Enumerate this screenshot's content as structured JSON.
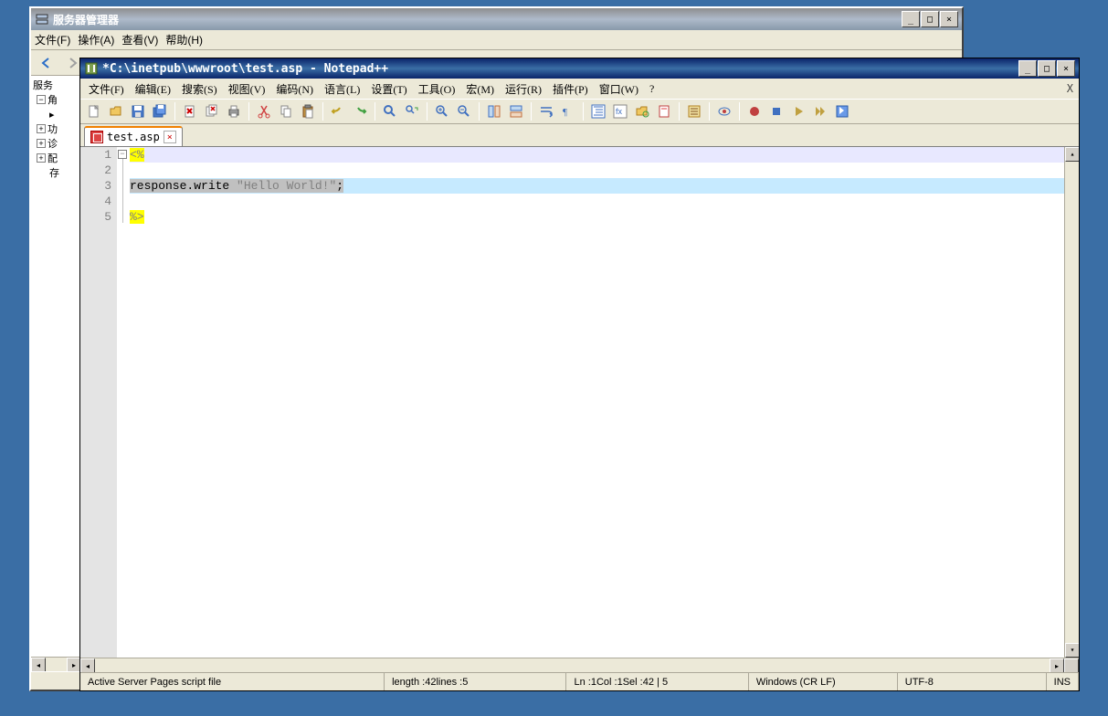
{
  "bg_window": {
    "title": "服务器管理器",
    "menu": [
      "文件(F)",
      "操作(A)",
      "查看(V)",
      "帮助(H)"
    ],
    "tree": {
      "root": "服务",
      "items": [
        "角",
        "功",
        "诊",
        "配",
        "存"
      ]
    }
  },
  "npp": {
    "title": "*C:\\inetpub\\wwwroot\\test.asp - Notepad++",
    "menu": [
      "文件(F)",
      "编辑(E)",
      "搜索(S)",
      "视图(V)",
      "编码(N)",
      "语言(L)",
      "设置(T)",
      "工具(O)",
      "宏(M)",
      "运行(R)",
      "插件(P)",
      "窗口(W)",
      "?"
    ],
    "tab": "test.asp",
    "code": {
      "line1": "<%",
      "line3_a": "response.write ",
      "line3_b": "\"Hello World!\"",
      "line3_c": ";",
      "line5": "%>"
    },
    "status": {
      "type": "Active Server Pages script file",
      "length_label": "length : ",
      "length_val": "42",
      "lines_label": "    lines : ",
      "lines_val": "5",
      "ln_label": "Ln : ",
      "ln_val": "1",
      "col_label": "    Col : ",
      "col_val": "1",
      "sel_label": "    Sel : ",
      "sel_val": "42 | 5",
      "eol": "Windows (CR LF)",
      "enc": "UTF-8",
      "ins": "INS"
    }
  }
}
